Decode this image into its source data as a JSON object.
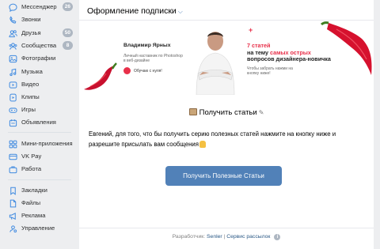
{
  "sidebar": {
    "items": [
      {
        "label": "Мессенджер",
        "badge": "26",
        "icon": "chat-bubble-icon"
      },
      {
        "label": "Звонки",
        "badge": "",
        "icon": "phone-icon"
      },
      {
        "label": "Друзья",
        "badge": "50",
        "icon": "friends-icon"
      },
      {
        "label": "Сообщества",
        "badge": "8",
        "icon": "communities-icon"
      },
      {
        "label": "Фотографии",
        "badge": "",
        "icon": "photo-icon"
      },
      {
        "label": "Музыка",
        "badge": "",
        "icon": "music-icon"
      },
      {
        "label": "Видео",
        "badge": "",
        "icon": "video-icon"
      },
      {
        "label": "Клипы",
        "badge": "",
        "icon": "clips-icon"
      },
      {
        "label": "Игры",
        "badge": "",
        "icon": "games-icon"
      },
      {
        "label": "Объявления",
        "badge": "",
        "icon": "ads-icon"
      },
      {
        "label": "Мини-приложения",
        "badge": "",
        "icon": "mini-apps-icon"
      },
      {
        "label": "VK Pay",
        "badge": "",
        "icon": "vk-pay-icon"
      },
      {
        "label": "Работа",
        "badge": "",
        "icon": "work-icon"
      },
      {
        "label": "Закладки",
        "badge": "",
        "icon": "bookmark-icon"
      },
      {
        "label": "Файлы",
        "badge": "",
        "icon": "file-icon"
      },
      {
        "label": "Реклама",
        "badge": "",
        "icon": "megaphone-icon"
      },
      {
        "label": "Управление",
        "badge": "",
        "icon": "manage-icon"
      }
    ]
  },
  "header": {
    "title": "Оформление подписки"
  },
  "banner": {
    "author_name": "Владимир Ярных",
    "author_sub": "Личный наставник по Photoshop в веб-дизайне",
    "learn_label": "Обучаю с нуля!",
    "headline_1": "7 статей",
    "headline_2": "на тему ",
    "headline_red": "самых острых",
    "headline_3": "вопросов дизайнера-новичка",
    "tagline": "Чтобы забрать нажми на кнопку ниже!"
  },
  "content": {
    "title": "Получить статьи",
    "message": "Евгений, для того, что бы получить серию полезных статей нажмите на кнопку ниже и разрешите присылать вам сообщения",
    "cta_label": "Получить Полезные Статьи"
  },
  "footer": {
    "prefix": "Разработчик: ",
    "developer": "Senler",
    "divider": " | ",
    "service": "Сервис рассылок",
    "info": "i"
  },
  "colors": {
    "accent": "#5181b8",
    "badge": "#aeb7c2",
    "red": "#e8304a",
    "link": "#2a5885"
  }
}
